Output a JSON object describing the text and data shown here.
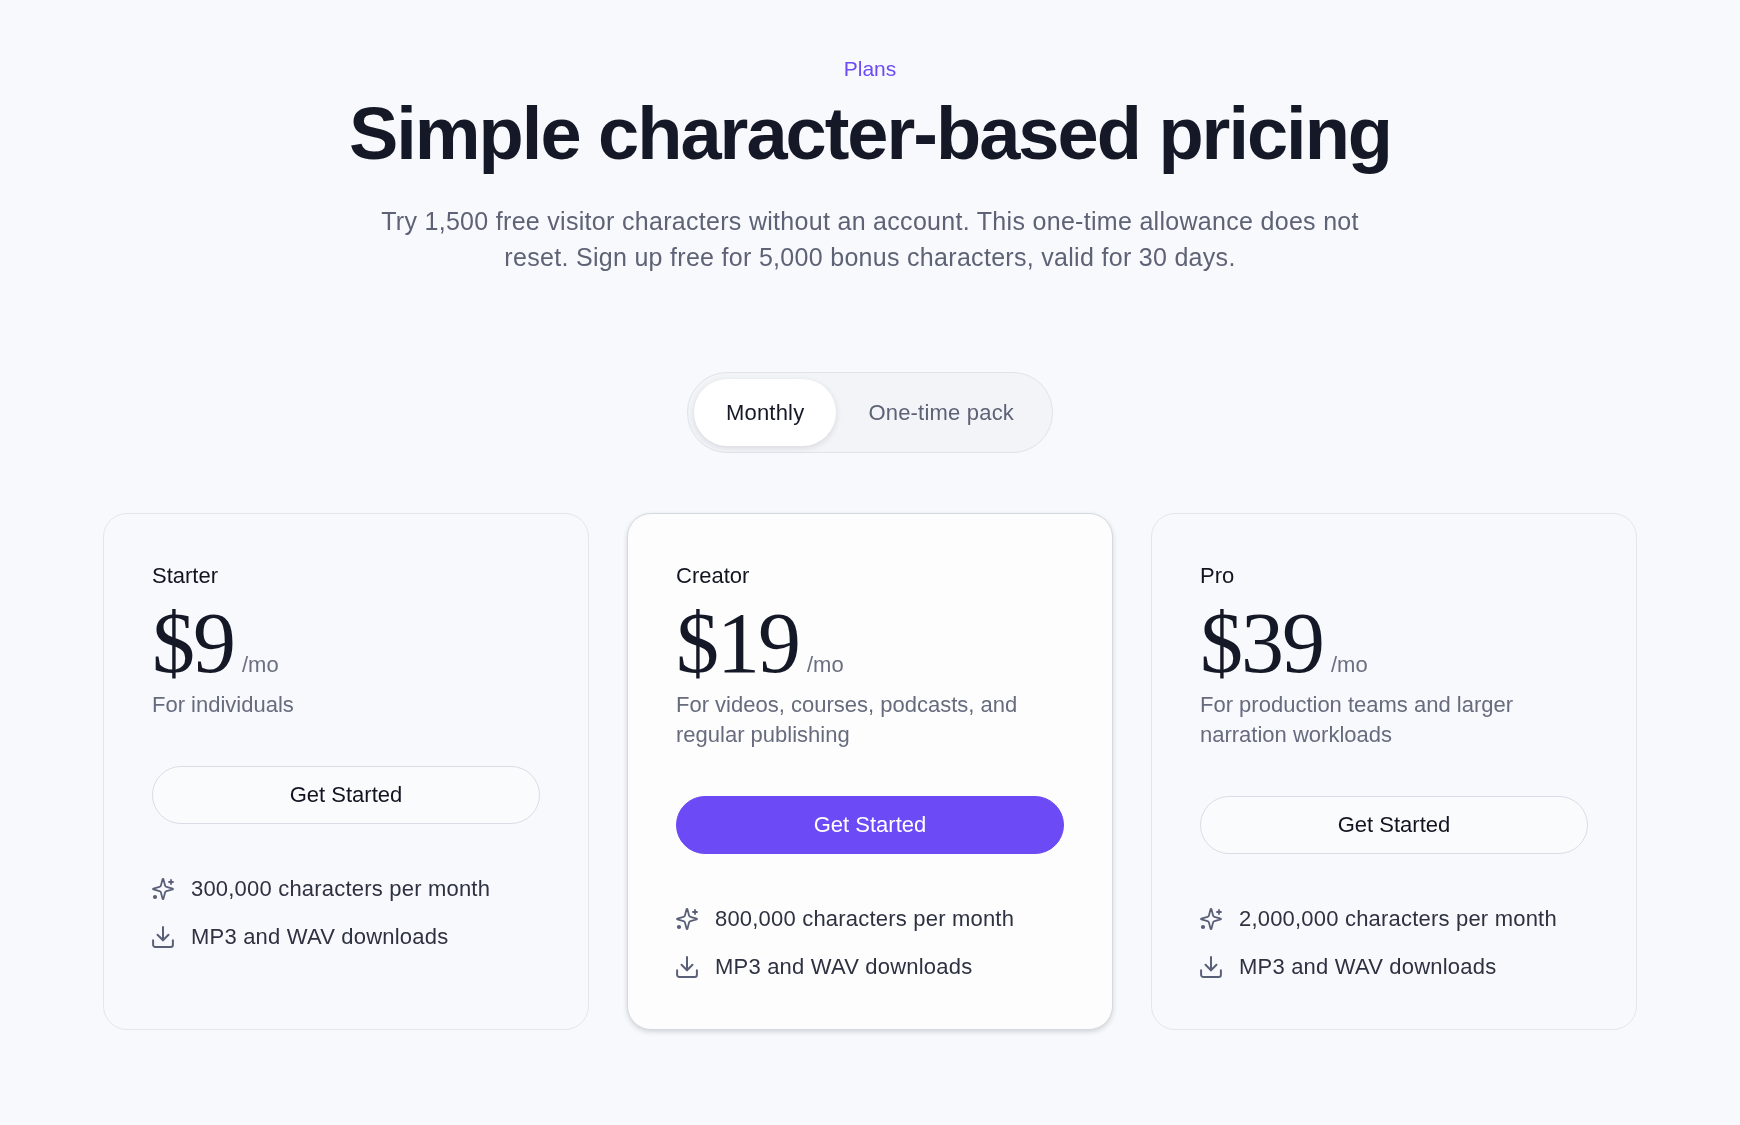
{
  "header": {
    "eyebrow": "Plans",
    "title": "Simple character-based pricing",
    "subtitle": "Try 1,500 free visitor characters without an account. This one-time allowance does not reset. Sign up free for 5,000 bonus characters, valid for 30 days."
  },
  "billing_toggle": [
    {
      "label": "Monthly",
      "selected": true
    },
    {
      "label": "One-time pack",
      "selected": false
    }
  ],
  "plans": [
    {
      "name": "Starter",
      "price": "$9",
      "period": "/mo",
      "description": "For individuals",
      "button": "Get Started",
      "highlighted": false,
      "features": [
        {
          "kind": "quota",
          "text": "300,000 characters per month"
        },
        {
          "kind": "download",
          "text": "MP3 and WAV downloads"
        }
      ]
    },
    {
      "name": "Creator",
      "price": "$19",
      "period": "/mo",
      "description": "For videos, courses, podcasts, and regular publishing",
      "button": "Get Started",
      "highlighted": true,
      "features": [
        {
          "kind": "quota",
          "text": "800,000 characters per month"
        },
        {
          "kind": "download",
          "text": "MP3 and WAV downloads"
        }
      ]
    },
    {
      "name": "Pro",
      "price": "$39",
      "period": "/mo",
      "description": "For production teams and larger narration workloads",
      "button": "Get Started",
      "highlighted": false,
      "features": [
        {
          "kind": "quota",
          "text": "2,000,000 characters per month"
        },
        {
          "kind": "download",
          "text": "MP3 and WAV downloads"
        }
      ]
    }
  ]
}
